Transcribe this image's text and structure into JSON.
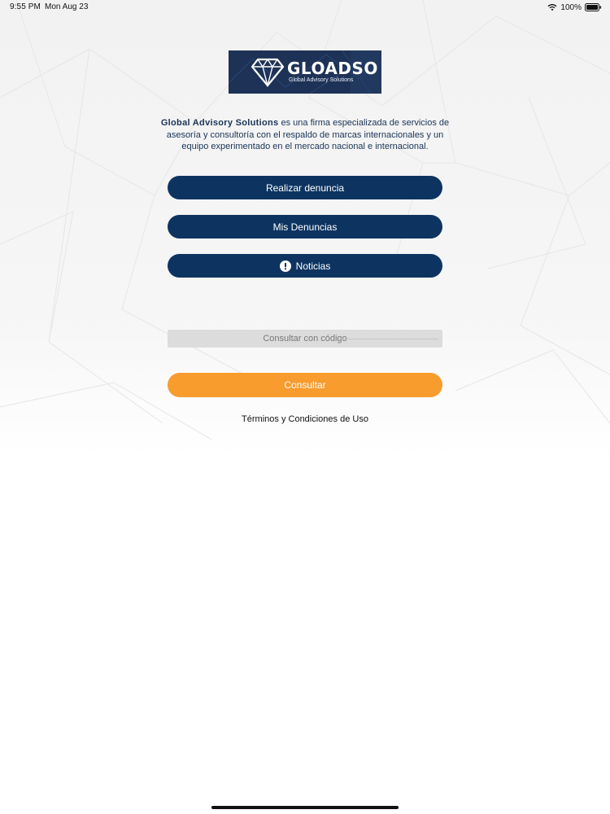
{
  "status_bar": {
    "time": "9:55 PM",
    "date": "Mon Aug 23",
    "battery": "100%"
  },
  "logo": {
    "wordmark": "GLOADSO",
    "tagline": "Global Advisory Solutions",
    "colors": {
      "background": "#1d3256",
      "text": "#ffffff"
    }
  },
  "description": {
    "brand": "Global Advisory Solutions",
    "text": " es una firma especializada de servicios de asesoría y consultoría con el respaldo de marcas internacionales y un equipo experimentado en el mercado nacional e internacional."
  },
  "actions": {
    "report_label": "Realizar denuncia",
    "my_reports_label": "Mis Denuncias",
    "news_label": "Noticias",
    "news_icon": "alert-circle-icon"
  },
  "consult": {
    "code_placeholder": "Consultar con código",
    "button_label": "Consultar"
  },
  "footer": {
    "terms_label": "Términos y Condiciones de Uso"
  },
  "colors": {
    "primary": "#0d3461",
    "accent": "#f89c2e",
    "input_bg": "#dcdcdc",
    "text_dark": "#1a3456"
  }
}
